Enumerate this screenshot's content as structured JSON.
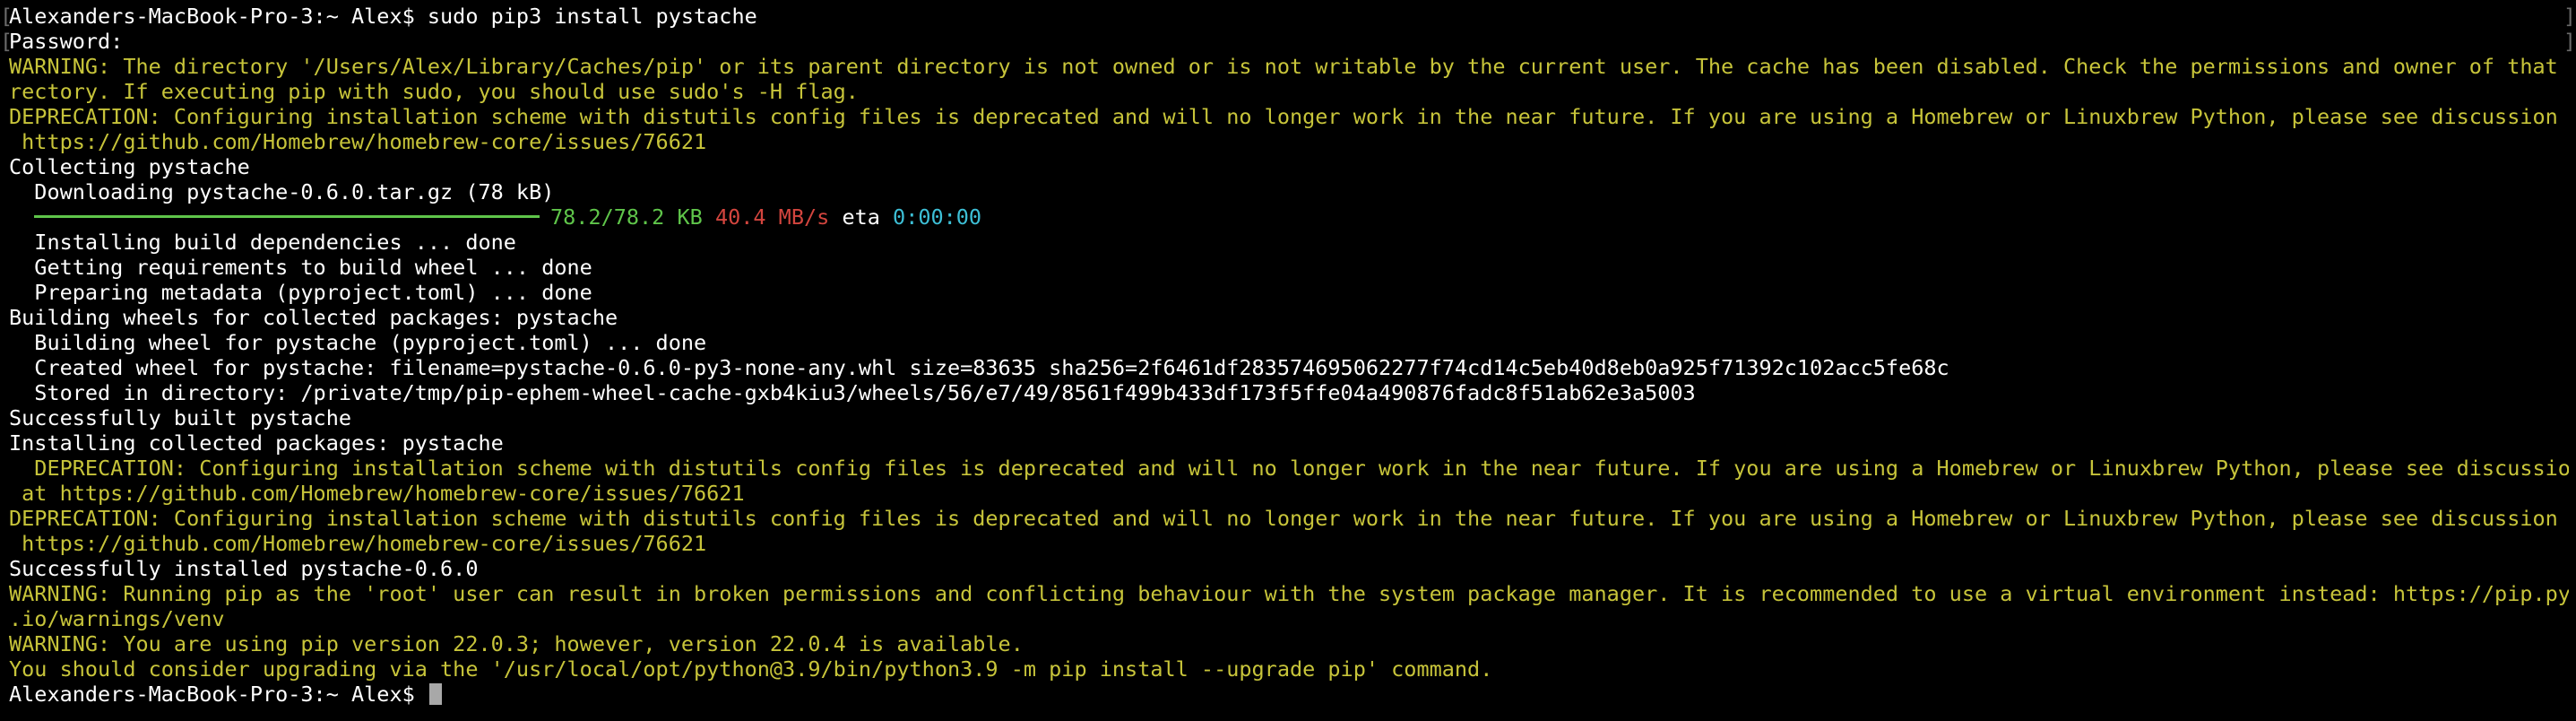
{
  "colors": {
    "background": "#000000",
    "text": "#ffffff",
    "warning": "#c7c43a",
    "progress_green": "#5fc54a",
    "speed_red": "#d3453e",
    "eta_cyan": "#3dbfd6",
    "cursor": "#a8a8a8"
  },
  "lines": [
    {
      "text": "Alexanders-MacBook-Pro-3:~ Alex$ sudo pip3 install pystache",
      "style": "normal"
    },
    {
      "text": "Password:",
      "style": "normal"
    },
    {
      "text": "WARNING: The directory '/Users/Alex/Library/Caches/pip' or its parent directory is not owned or is not writable by the current user. The cache has been disabled. Check the permissions and owner of that di",
      "style": "warn"
    },
    {
      "text": "rectory. If executing pip with sudo, you should use sudo's -H flag.",
      "style": "warn"
    },
    {
      "text": "DEPRECATION: Configuring installation scheme with distutils config files is deprecated and will no longer work in the near future. If you are using a Homebrew or Linuxbrew Python, please see discussion at",
      "style": "warn"
    },
    {
      "text": " https://github.com/Homebrew/homebrew-core/issues/76621",
      "style": "warn"
    },
    {
      "text": "Collecting pystache",
      "style": "normal"
    },
    {
      "text": "  Downloading pystache-0.6.0.tar.gz (78 kB)",
      "style": "normal"
    },
    {
      "text": "",
      "style": "progress"
    },
    {
      "text": "  Installing build dependencies ... done",
      "style": "normal"
    },
    {
      "text": "  Getting requirements to build wheel ... done",
      "style": "normal"
    },
    {
      "text": "  Preparing metadata (pyproject.toml) ... done",
      "style": "normal"
    },
    {
      "text": "Building wheels for collected packages: pystache",
      "style": "normal"
    },
    {
      "text": "  Building wheel for pystache (pyproject.toml) ... done",
      "style": "normal"
    },
    {
      "text": "  Created wheel for pystache: filename=pystache-0.6.0-py3-none-any.whl size=83635 sha256=2f6461df283574695062277f74cd14c5eb40d8eb0a925f71392c102acc5fe68c",
      "style": "normal"
    },
    {
      "text": "  Stored in directory: /private/tmp/pip-ephem-wheel-cache-gxb4kiu3/wheels/56/e7/49/8561f499b433df173f5ffe04a490876fadc8f51ab62e3a5003",
      "style": "normal"
    },
    {
      "text": "Successfully built pystache",
      "style": "normal"
    },
    {
      "text": "Installing collected packages: pystache",
      "style": "normal"
    },
    {
      "text": "  DEPRECATION: Configuring installation scheme with distutils config files is deprecated and will no longer work in the near future. If you are using a Homebrew or Linuxbrew Python, please see discussion",
      "style": "warn"
    },
    {
      "text": " at https://github.com/Homebrew/homebrew-core/issues/76621",
      "style": "warn"
    },
    {
      "text": "DEPRECATION: Configuring installation scheme with distutils config files is deprecated and will no longer work in the near future. If you are using a Homebrew or Linuxbrew Python, please see discussion at",
      "style": "warn"
    },
    {
      "text": " https://github.com/Homebrew/homebrew-core/issues/76621",
      "style": "warn"
    },
    {
      "text": "Successfully installed pystache-0.6.0",
      "style": "normal"
    },
    {
      "text": "WARNING: Running pip as the 'root' user can result in broken permissions and conflicting behaviour with the system package manager. It is recommended to use a virtual environment instead: https://pip.pypa",
      "style": "warn"
    },
    {
      "text": ".io/warnings/venv",
      "style": "warn"
    },
    {
      "text": "WARNING: You are using pip version 22.0.3; however, version 22.0.4 is available.",
      "style": "warn"
    },
    {
      "text": "You should consider upgrading via the '/usr/local/opt/python@3.9/bin/python3.9 -m pip install --upgrade pip' command.",
      "style": "warn"
    },
    {
      "text": "Alexanders-MacBook-Pro-3:~ Alex$ ",
      "style": "prompt"
    }
  ],
  "progress": {
    "fraction": 1.0,
    "size": "78.2/78.2 KB",
    "speed": "40.4 MB/s",
    "eta_label": "eta",
    "eta": "0:00:00"
  },
  "edge_marks": {
    "left": "[",
    "right": "]"
  }
}
